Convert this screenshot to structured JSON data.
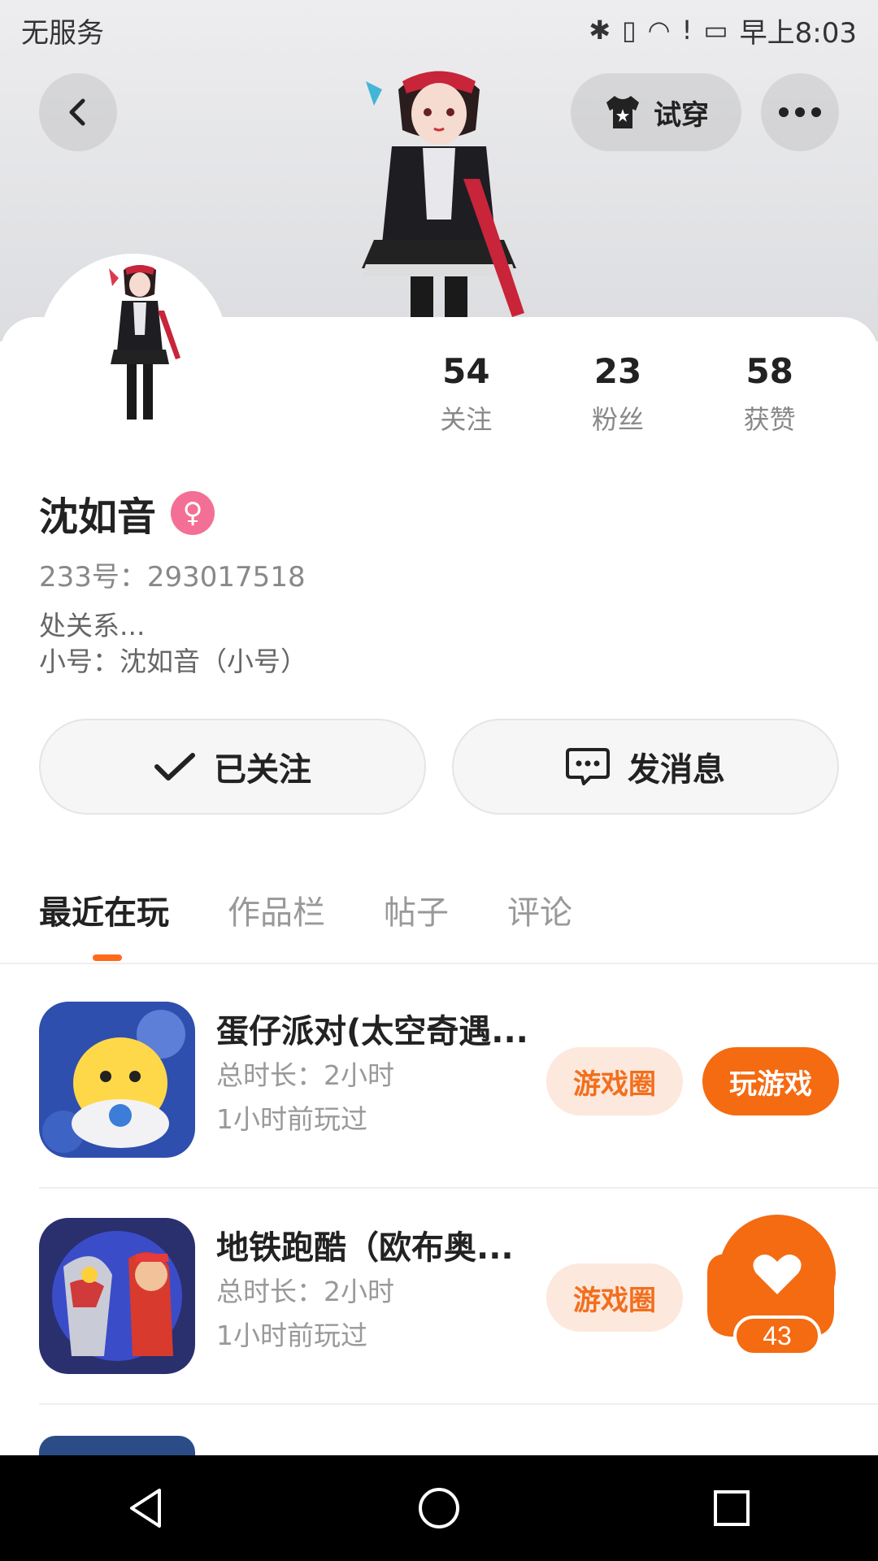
{
  "status_bar": {
    "carrier": "无服务",
    "time": "早上8:03",
    "icons": [
      "bluetooth-icon",
      "vibrate-icon",
      "wifi-icon",
      "alert-icon",
      "battery-icon"
    ]
  },
  "header": {
    "tryon_label": "试穿"
  },
  "profile": {
    "stats": [
      {
        "num": "54",
        "label": "关注"
      },
      {
        "num": "23",
        "label": "粉丝"
      },
      {
        "num": "58",
        "label": "获赞"
      }
    ],
    "name": "沈如音",
    "gender_symbol": "♀",
    "uid": "233号：293017518",
    "bio_line1": "处关系...",
    "bio_line2": "小号：沈如音（小号）"
  },
  "actions": {
    "follow_label": "已关注",
    "message_label": "发消息"
  },
  "tabs": [
    {
      "label": "最近在玩",
      "active": true
    },
    {
      "label": "作品栏",
      "active": false
    },
    {
      "label": "帖子",
      "active": false
    },
    {
      "label": "评论",
      "active": false
    }
  ],
  "games": [
    {
      "name": "蛋仔派对(太空奇遇...",
      "duration": "总时长：2小时",
      "last_played": "1小时前玩过",
      "circle_label": "游戏圈",
      "play_label": "玩游戏"
    },
    {
      "name": "地铁跑酷（欧布奥...",
      "duration": "总时长：2小时",
      "last_played": "1小时前玩过",
      "circle_label": "游戏圈"
    }
  ],
  "like_widget": {
    "count": "43"
  },
  "colors": {
    "accent": "#f46b12",
    "accent_light": "#fde8dd",
    "gender_badge": "#f46f95"
  }
}
